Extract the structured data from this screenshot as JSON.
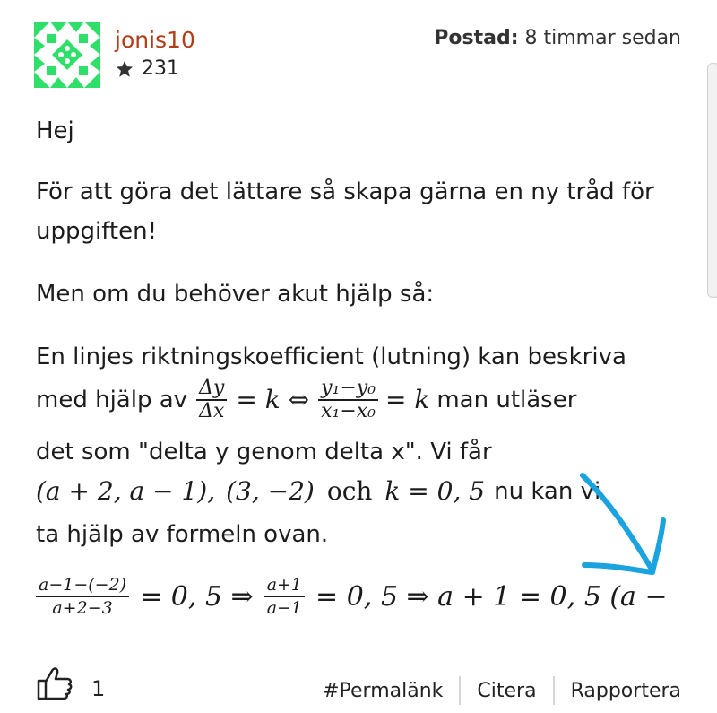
{
  "author": {
    "username": "jonis10",
    "reputation": "231",
    "reputation_icon": "star-icon"
  },
  "posted": {
    "label": "Postad:",
    "time": "8 timmar sedan"
  },
  "content": {
    "greeting": "Hej",
    "para1": "För att göra det lättare så skapa gärna en ny tråd för uppgiften!",
    "para2": "Men om du behöver akut hjälp så:",
    "para3_a": "En linjes riktningskoefficient (lutning) kan beskriva",
    "para3_b": "med hjälp av",
    "para3_c": "man utläser",
    "para3_d": "det som \"delta y genom delta x\". Vi får",
    "para3_e": "nu kan vi",
    "para3_f": "ta hjälp av formeln ovan.",
    "math_point1": "(a + 2, a − 1),",
    "math_point2": "(3, −2)",
    "math_och": "och",
    "math_k": "k = 0, 5",
    "delta_num": "Δy",
    "delta_den": "Δx",
    "eq_k": "= k ⇔",
    "y_num": "y₁−y₀",
    "x_den": "x₁−x₀",
    "eq_k2": "= k",
    "calc_frac1_num": "a−1−(−2)",
    "calc_frac1_den": "a+2−3",
    "calc_eq1": "= 0, 5 ⇒",
    "calc_frac2_num": "a+1",
    "calc_frac2_den": "a−1",
    "calc_eq2": "= 0, 5 ⇒ a + 1 = 0, 5 (a −"
  },
  "footer": {
    "like_count": "1",
    "like_icon": "thumbs-up-icon",
    "permalink": "#Permalänk",
    "quote": "Citera",
    "report": "Rapportera"
  },
  "colors": {
    "username": "#b23c17",
    "avatar": "#2ee06a",
    "annotation_arrow": "#1aa3de"
  }
}
